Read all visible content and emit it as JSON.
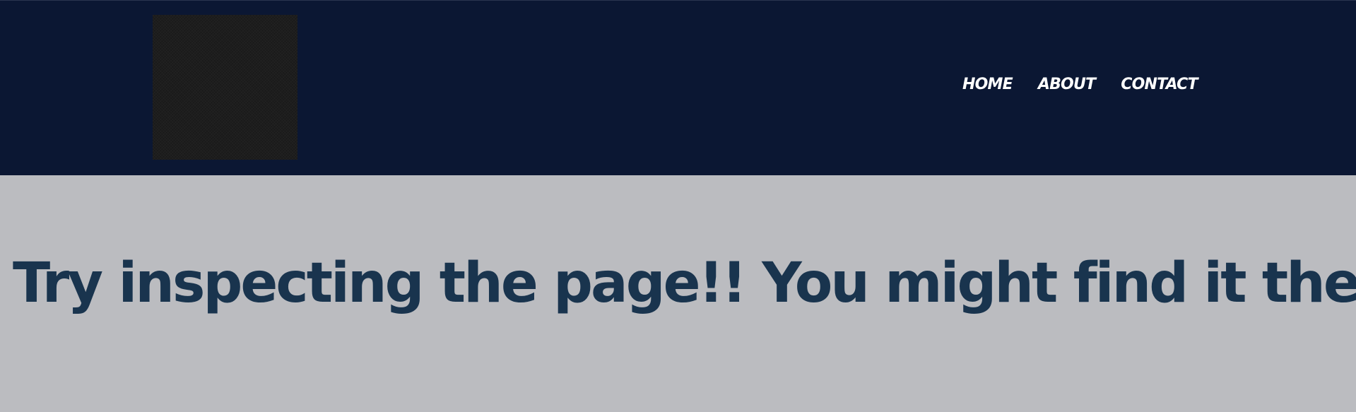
{
  "header": {
    "logo_icon": "dark-square-logo",
    "nav": {
      "items": [
        {
          "label": "HOME"
        },
        {
          "label": "ABOUT"
        },
        {
          "label": "CONTACT"
        }
      ]
    }
  },
  "main": {
    "headline": "Try inspecting the page!! You might find it there"
  },
  "colors": {
    "header_background": "#0b1733",
    "page_background": "#bbbcc0",
    "headline_text": "#19344e",
    "nav_text": "#ffffff",
    "logo_background": "#1a1a1a"
  }
}
